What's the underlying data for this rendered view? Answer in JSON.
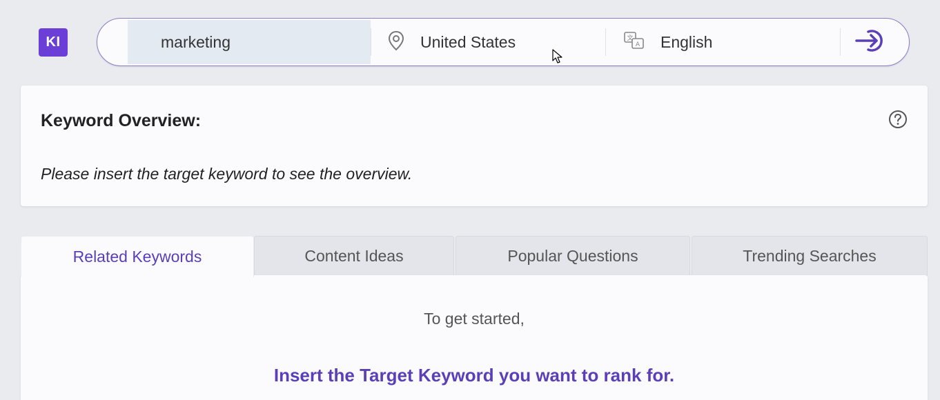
{
  "logo": {
    "text": "KI"
  },
  "search": {
    "keyword_value": "marketing",
    "location": "United States",
    "language": "English"
  },
  "overview": {
    "title": "Keyword Overview:",
    "message": "Please insert the target keyword to see the overview."
  },
  "tabs": [
    {
      "label": "Related Keywords",
      "active": true
    },
    {
      "label": "Content Ideas",
      "active": false
    },
    {
      "label": "Popular Questions",
      "active": false
    },
    {
      "label": "Trending Searches",
      "active": false
    }
  ],
  "panel": {
    "intro": "To get started,",
    "cta": "Insert the Target Keyword you want to rank for."
  },
  "colors": {
    "brand": "#6c3ed8",
    "accent_text": "#5a3fb8"
  },
  "icons": {
    "location": "map-pin-icon",
    "language": "translate-icon",
    "submit": "arrow-login-icon",
    "help": "question-circle-icon"
  }
}
